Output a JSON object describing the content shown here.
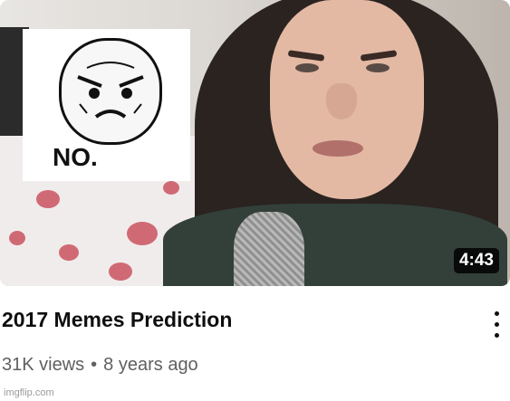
{
  "video": {
    "duration": "4:43",
    "meme_caption": "NO.",
    "title": "2017 Memes Prediction",
    "views": "31K views",
    "separator": "•",
    "age": "8 years ago"
  },
  "watermark": "imgflip.com",
  "colors": {
    "title": "#0f0f0f",
    "meta": "#606060",
    "duration_bg": "#000000"
  },
  "icons": [
    "more-vert-icon",
    "rage-face-icon"
  ]
}
